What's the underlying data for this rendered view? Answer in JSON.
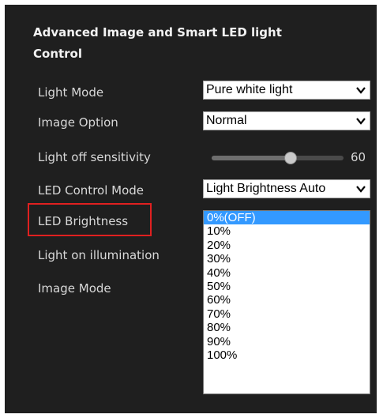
{
  "section_title": "Advanced Image and Smart LED light Control",
  "rows": {
    "light_mode": {
      "label": "Light Mode",
      "value": "Pure white light"
    },
    "image_option": {
      "label": "Image Option",
      "value": "Normal"
    },
    "light_off_sensitivity": {
      "label": "Light off sensitivity",
      "value": "60"
    },
    "led_control_mode": {
      "label": "LED Control Mode",
      "value": "Light Brightness Auto"
    },
    "led_brightness": {
      "label": "LED Brightness"
    },
    "light_on_illumination": {
      "label": "Light on illumination"
    },
    "image_mode": {
      "label": "Image Mode"
    }
  },
  "brightness_options": [
    "0%(OFF)",
    "10%",
    "20%",
    "30%",
    "40%",
    "50%",
    "60%",
    "70%",
    "80%",
    "90%",
    "100%"
  ],
  "selected_option_index": 0,
  "slider_level_fraction": 0.6,
  "colors": {
    "panel_bg": "#1f1f1f",
    "highlight_border": "#e02020",
    "selected_option_bg": "#3399ff"
  },
  "icons": {
    "dropdown": "chevron-down-icon",
    "slider_knob": "slider-knob"
  }
}
